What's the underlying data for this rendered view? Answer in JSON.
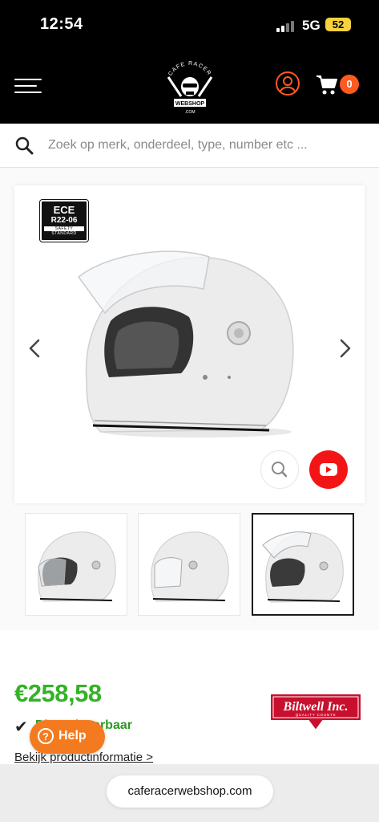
{
  "status_bar": {
    "time": "12:54",
    "network": "5G",
    "battery": "52"
  },
  "header": {
    "logo_top": "CAFE RACER",
    "logo_bottom": "WEBSHOP",
    "logo_dotcom": ".COM",
    "cart_count": "0"
  },
  "search": {
    "placeholder": "Zoek op merk, onderdeel, type, number etc ..."
  },
  "product": {
    "badge_line1": "ECE",
    "badge_line2": "R22-06",
    "badge_line3": "SAFETY",
    "badge_line4": "STANDARD",
    "price": "€258,58",
    "stock_status": "Direct leverbaar",
    "brand_name": "Biltwell Inc.",
    "brand_tagline": "QUALITY COUNTS",
    "info_link": "Bekijk productinformatie >"
  },
  "help": {
    "label": "Help",
    "icon_glyph": "?"
  },
  "browser": {
    "url": "caferacerwebshop.com"
  },
  "colors": {
    "accent": "#ff5a1f",
    "price": "#34b227",
    "youtube": "#f31515",
    "help": "#f47a1f"
  }
}
